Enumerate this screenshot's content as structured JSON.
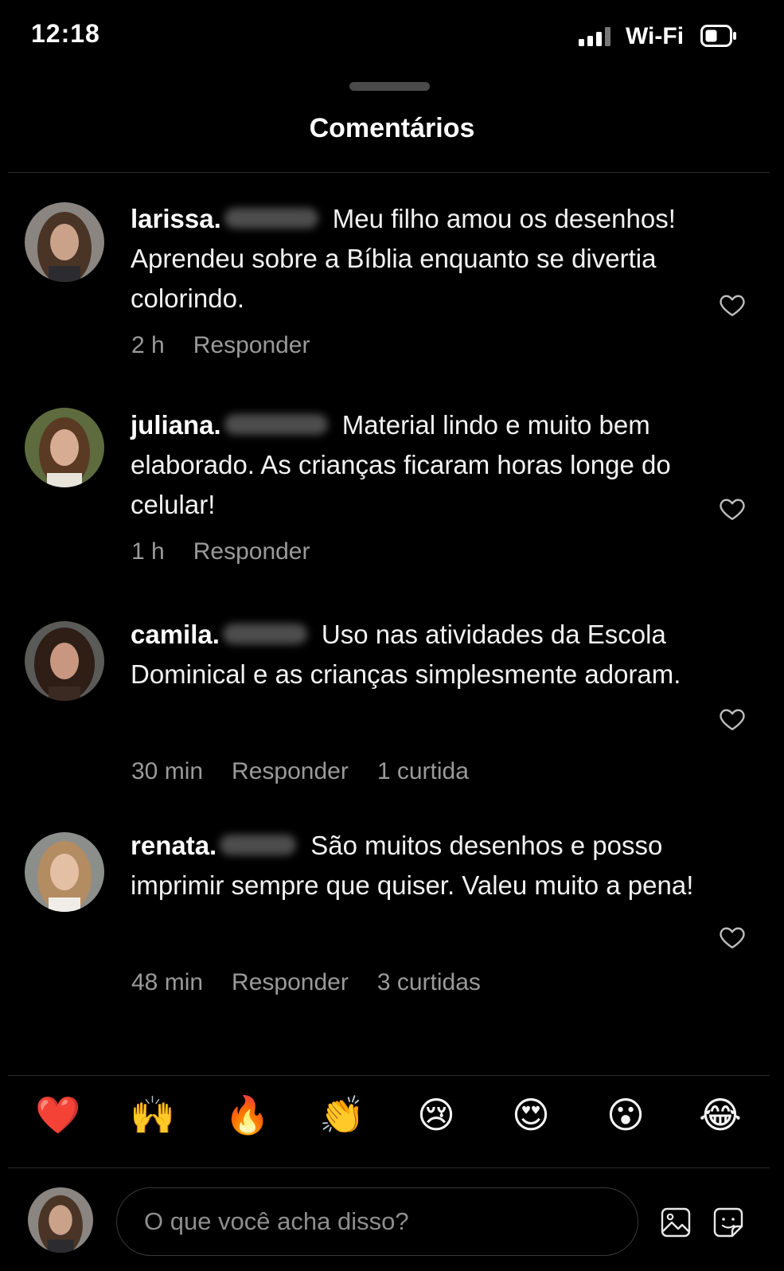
{
  "status_bar": {
    "time": "12:18",
    "network": "Wi-Fi",
    "icons": [
      "signal-bars-icon",
      "battery-icon"
    ]
  },
  "sheet": {
    "title": "Comentários"
  },
  "comments": [
    {
      "username": "larissa.",
      "text": "Meu filho amou os desenhos! Aprendeu sobre a Bíblia enquanto se divertia colorindo.",
      "time": "2 h",
      "reply_label": "Responder",
      "likes": ""
    },
    {
      "username": "juliana.",
      "text": "Material lindo e muito bem elaborado. As crianças ficaram horas longe do celular!",
      "time": "1 h",
      "reply_label": "Responder",
      "likes": ""
    },
    {
      "username": "camila.",
      "text": "Uso nas atividades da Escola Dominical e as crianças simplesmente adoram.",
      "time": "30 min",
      "reply_label": "Responder",
      "likes": "1 curtida"
    },
    {
      "username": "renata.",
      "text": "São muitos desenhos e posso imprimir sempre que quiser. Valeu muito a pena!",
      "time": "48 min",
      "reply_label": "Responder",
      "likes": "3 curtidas"
    }
  ],
  "reactions": [
    "❤️",
    "🙌",
    "🔥",
    "👏",
    "😢",
    "😍",
    "😮",
    "😂"
  ],
  "composer": {
    "placeholder": "O que você acha disso?"
  },
  "colors": {
    "background": "#000000",
    "text": "#f2f2f2",
    "muted": "#9a9a9a",
    "divider": "#2a2a2a"
  }
}
